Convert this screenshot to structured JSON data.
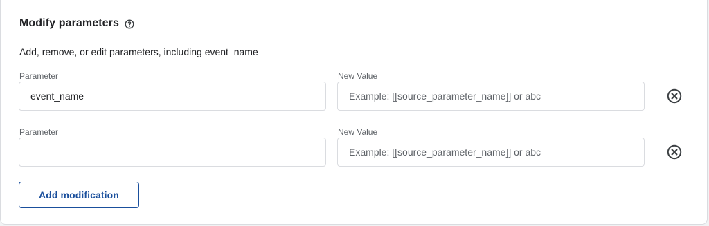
{
  "section": {
    "title": "Modify parameters",
    "help_icon": "help-circle-icon",
    "description": "Add, remove, or edit parameters, including event_name"
  },
  "rows": [
    {
      "parameter_label": "Parameter",
      "parameter_value": "event_name",
      "parameter_placeholder": "",
      "new_value_label": "New Value",
      "new_value_value": "",
      "new_value_placeholder": "Example: [[source_parameter_name]] or abc",
      "remove_icon": "remove-circle-x-icon"
    },
    {
      "parameter_label": "Parameter",
      "parameter_value": "",
      "parameter_placeholder": "",
      "new_value_label": "New Value",
      "new_value_value": "",
      "new_value_placeholder": "Example: [[source_parameter_name]] or abc",
      "remove_icon": "remove-circle-x-icon"
    }
  ],
  "add_button": {
    "label": "Add modification"
  },
  "colors": {
    "accent": "#1a4f9c",
    "border": "#dadce0",
    "text": "#202124",
    "muted": "#5f6368",
    "icon": "#3c4043"
  }
}
